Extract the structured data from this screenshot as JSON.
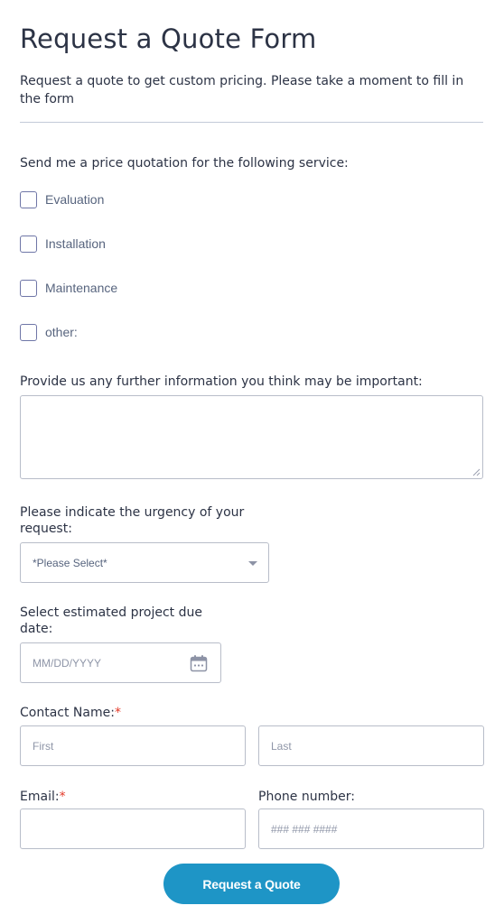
{
  "form": {
    "title": "Request a Quote Form",
    "subtitle": "Request a quote to get custom pricing. Please take a moment to fill in the form"
  },
  "services": {
    "label": "Send me a price quotation for the following service:",
    "options": [
      "Evaluation",
      "Installation",
      "Maintenance",
      "other:"
    ]
  },
  "further_info": {
    "label": "Provide us any further information you think may be important:",
    "value": ""
  },
  "urgency": {
    "label_line1": "Please indicate the urgency of your",
    "label_line2": "request:",
    "selected": "*Please Select*"
  },
  "due_date": {
    "label_line1": "Select estimated project due",
    "label_line2": "date:",
    "placeholder": "MM/DD/YYYY",
    "icon": "calendar-icon"
  },
  "contact_name": {
    "label": "Contact Name:",
    "required_mark": "*",
    "first_placeholder": "First",
    "last_placeholder": "Last"
  },
  "email": {
    "label": "Email:",
    "required_mark": "*",
    "value": ""
  },
  "phone": {
    "label": "Phone number:",
    "placeholder": "### ### ####"
  },
  "submit": {
    "label": "Request a Quote",
    "color": "#1e95c6"
  },
  "colors": {
    "required": "#e33a29",
    "text": "#2c3345",
    "border": "#b8bdc9"
  }
}
